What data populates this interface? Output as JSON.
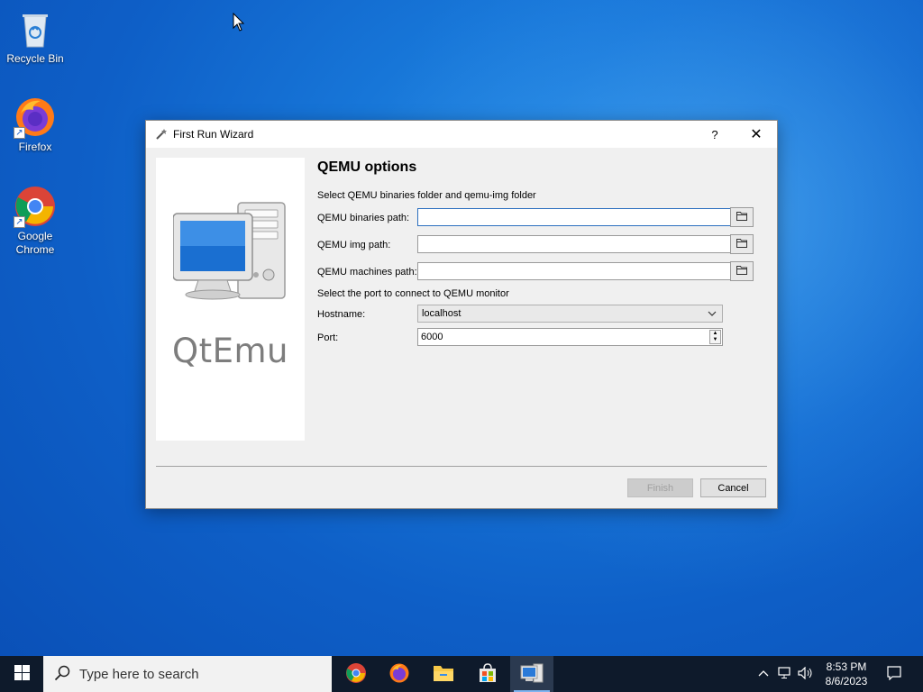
{
  "desktop": {
    "icons": [
      {
        "label": "Recycle Bin"
      },
      {
        "label": "Firefox"
      },
      {
        "label": "Google Chrome"
      }
    ]
  },
  "dialog": {
    "title": "First Run Wizard",
    "help_label": "?",
    "close_label": "✕",
    "logo_text": "QtEmu",
    "page_title": "QEMU options",
    "binaries_section": "Select QEMU binaries folder and qemu-img folder",
    "fields": {
      "binaries_label": "QEMU binaries path:",
      "binaries_value": "",
      "img_label": "QEMU img path:",
      "img_value": "",
      "machines_label": "QEMU machines path:",
      "machines_value": ""
    },
    "monitor_section": "Select the port to connect to QEMU monitor",
    "hostname_label": "Hostname:",
    "hostname_value": "localhost",
    "port_label": "Port:",
    "port_value": "6000",
    "finish_label": "Finish",
    "cancel_label": "Cancel"
  },
  "taskbar": {
    "search_placeholder": "Type here to search",
    "apps": [
      "chrome-icon",
      "firefox-icon",
      "file-explorer-icon",
      "store-icon",
      "qtemu-icon"
    ],
    "time": "8:53 PM",
    "date": "8/6/2023"
  },
  "colors": {
    "wallpaper": "#0e5fc7",
    "taskbar": "#0e1a2b",
    "dialog_bg": "#f0f0f0",
    "focus_border": "#2c6fbf"
  }
}
